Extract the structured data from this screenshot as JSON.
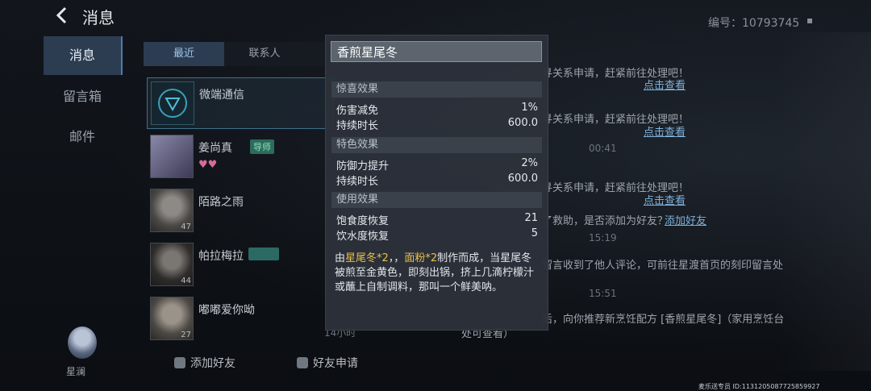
{
  "header": {
    "title": "消息",
    "id_label": "编号：10793745"
  },
  "nav": {
    "items": [
      {
        "label": "消息"
      },
      {
        "label": "留言箱"
      },
      {
        "label": "邮件"
      }
    ],
    "self_name": "星澜"
  },
  "tabs": [
    {
      "label": "最近"
    },
    {
      "label": "联系人"
    }
  ],
  "contacts": [
    {
      "name": "微端通信",
      "tag": "",
      "level": ""
    },
    {
      "name": "姜尚真",
      "tag": "导师",
      "level": ""
    },
    {
      "name": "陌路之雨",
      "tag": "",
      "level": "47"
    },
    {
      "name": "帕拉梅拉",
      "tag": "",
      "level": "44"
    },
    {
      "name": "嘟嘟爱你呦",
      "tag": "",
      "level": "27"
    }
  ],
  "contacts_subtime": "14小时",
  "bottom_buttons": {
    "add_friend": "添加好友",
    "friend_request": "好友申请"
  },
  "messages": {
    "m1": "寻关系申请，赶紧前往处理吧！",
    "m1_link": "点击查看",
    "m2": "寻关系申请，赶紧前往处理吧！",
    "m2_link": "点击查看",
    "t1": "00:41",
    "m3": "寻关系申请，赶紧前往处理吧！",
    "m3_link": "点击查看",
    "m4": "了救助，是否添加为好友？",
    "m4_link": "添加好友",
    "t2": "15:19",
    "m5": "留言收到了他人评论，可前往星渡首页的刻印留言处",
    "t3": "15:51",
    "m6": "后，向你推荐新烹饪配方 [香煎星尾冬]（家用烹饪台",
    "m7": "处可查看）"
  },
  "tooltip": {
    "title": "香煎星尾冬",
    "sections": [
      {
        "header": "惊喜效果",
        "rows": [
          {
            "label": "伤害减免",
            "value": "1%"
          },
          {
            "label": "持续时长",
            "value": "600.0"
          }
        ]
      },
      {
        "header": "特色效果",
        "rows": [
          {
            "label": "防御力提升",
            "value": "2%"
          },
          {
            "label": "持续时长",
            "value": "600.0"
          }
        ]
      },
      {
        "header": "使用效果",
        "rows": [
          {
            "label": "饱食度恢复",
            "value": "21"
          },
          {
            "label": "饮水度恢复",
            "value": "5"
          }
        ]
      }
    ],
    "desc_pre": "由",
    "desc_hl1": "星尾冬*2",
    "desc_mid": "，，",
    "desc_hl2": "面粉*2",
    "desc_post": "制作而成，当星尾冬被煎至金黄色，即刻出锅，挤上几滴柠檬汁或蘸上自制调料，那叫一个鲜美呐。"
  },
  "footer": {
    "id_text": "麦乐送专员 ID:1131205087725859927"
  },
  "colors": {
    "accent": "#2c3d52",
    "highlight": "#e6c24a",
    "link": "#7fb0d8"
  }
}
